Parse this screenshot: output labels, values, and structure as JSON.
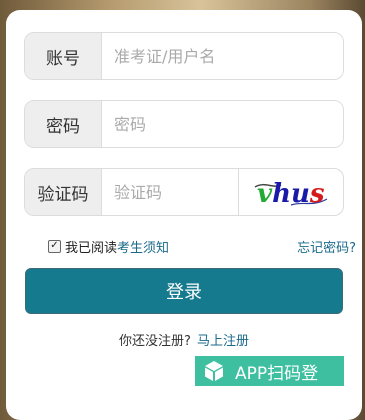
{
  "form": {
    "account": {
      "label": "账号",
      "placeholder": "准考证/用户名",
      "value": ""
    },
    "password": {
      "label": "密码",
      "placeholder": "密码",
      "value": ""
    },
    "captcha": {
      "label": "验证码",
      "placeholder": "验证码",
      "value": "",
      "image_text": "vhus"
    },
    "agreement": {
      "prefix": "我已阅读",
      "link": "考生须知",
      "checked": true
    },
    "forgot_label": "忘记密码?",
    "login_label": "登录",
    "register": {
      "prompt": "你还没注册?",
      "link": "马上注册"
    },
    "app_login_label": "APP扫码登"
  },
  "colors": {
    "primary": "#167a8f",
    "link": "#1a6a8a",
    "app_button": "#3dbfa0"
  }
}
